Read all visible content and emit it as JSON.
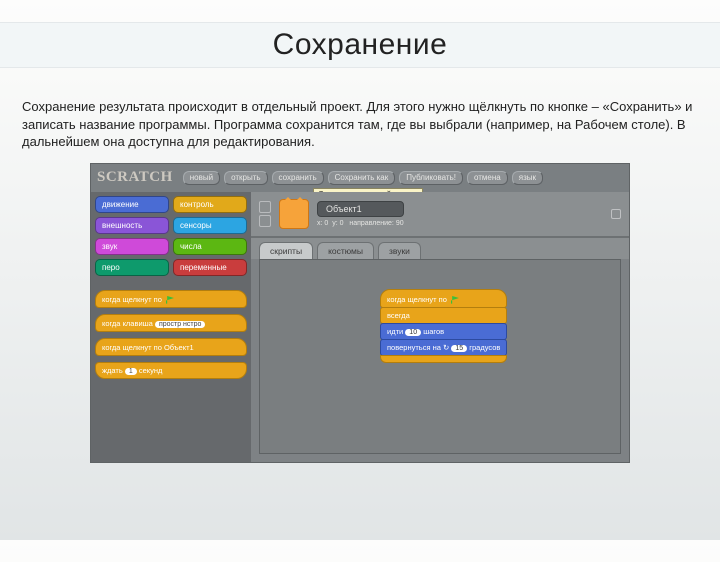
{
  "slide": {
    "title": "Сохранение",
    "body": "Сохранение результата происходит в отдельный проект. Для этого нужно щёлкнуть по кнопке – «Сохранить» и записать название программы. Программа сохранится там, где вы выбрали (например, на Рабочем столе). В дальнейшем она доступна для редактирования."
  },
  "scratch": {
    "logo": "SCRATCH",
    "toolbar": {
      "new": "новый",
      "open": "открыть",
      "save": "сохранить",
      "save_as": "Сохранить как",
      "publish": "Публиковать!",
      "undo": "отмена",
      "lang": "язык"
    },
    "tooltip": "Сохранить текущий проект",
    "categories": {
      "motion": "движение",
      "control": "контроль",
      "looks": "внешность",
      "sensing": "сенсоры",
      "sound": "звук",
      "numbers": "числа",
      "pen": "перо",
      "variables": "переменные"
    },
    "palette_blocks": {
      "hat_flag": "когда щелкнут по",
      "hat_key_prefix": "когда клавиша",
      "hat_key_arg": "простр нстро",
      "hat_sprite": "когда щелкнут по Объект1",
      "wait_prefix": "ждать",
      "wait_val": "1",
      "wait_suffix": "секунд"
    },
    "sprite": {
      "name": "Объект1",
      "x_label": "x:",
      "x_val": "0",
      "y_label": "y:",
      "y_val": "0",
      "dir_label": "направление:",
      "dir_val": "90"
    },
    "tabs": {
      "scripts": "скрипты",
      "costumes": "костюмы",
      "sounds": "звуки"
    },
    "script": {
      "hat": "когда щелкнут по",
      "forever": "всегда",
      "move_prefix": "идти",
      "move_val": "10",
      "move_suffix": "шагов",
      "turn_prefix": "повернуться на",
      "turn_val": "15",
      "turn_suffix": "градусов"
    }
  }
}
